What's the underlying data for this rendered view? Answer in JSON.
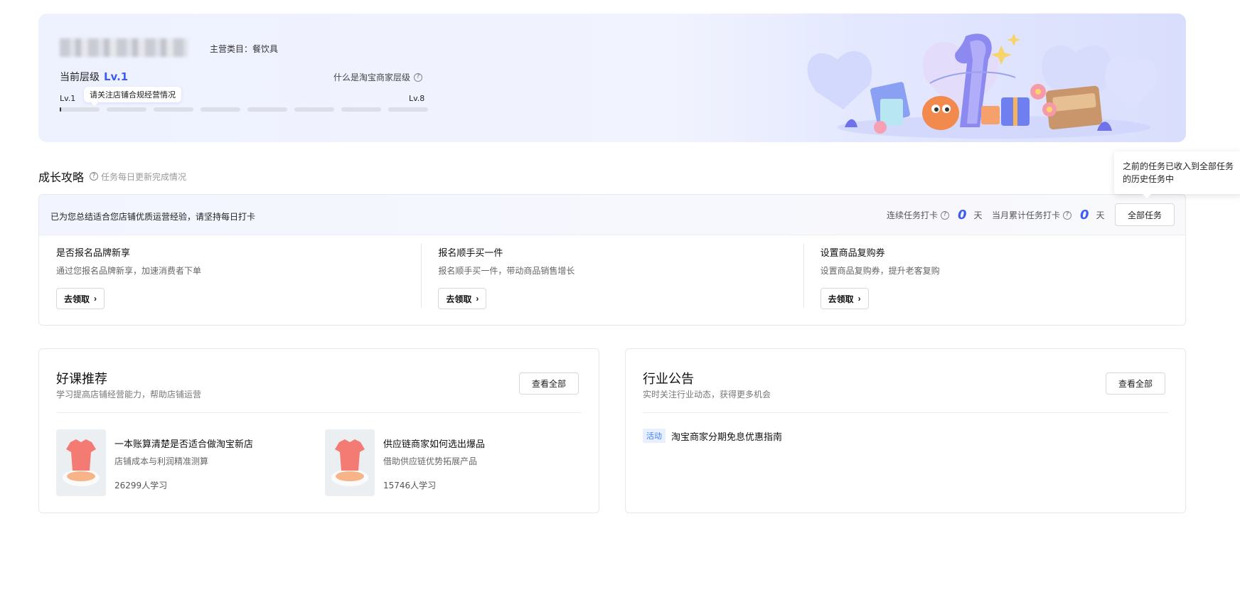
{
  "banner": {
    "category": "主营类目：餐饮具",
    "current_level_label": "当前层级",
    "current_level": "Lv.1",
    "what_is_level": "什么是淘宝商家层级",
    "level_start": "Lv.1",
    "level_end": "Lv.8",
    "level_tip": "请关注店铺合规经营情况",
    "level_segments": 8
  },
  "growth": {
    "title": "成长攻略",
    "subtitle": "任务每日更新完成情况",
    "summary": "已为您总结适合您店铺优质运营经验，请坚持每日打卡",
    "streak_label": "连续任务打卡",
    "streak_value": "0",
    "streak_unit": "天",
    "monthly_label": "当月累计任务打卡",
    "monthly_value": "0",
    "monthly_unit": "天",
    "all_tasks_label": "全部任务",
    "tooltip": "之前的任务已收入到全部任务的历史任务中",
    "tasks": [
      {
        "title": "是否报名品牌新享",
        "desc": "通过您报名品牌新享，加速消费者下单",
        "button": "去领取"
      },
      {
        "title": "报名顺手买一件",
        "desc": "报名顺手买一件，带动商品销售增长",
        "button": "去领取"
      },
      {
        "title": "设置商品复购券",
        "desc": "设置商品复购券，提升老客复购",
        "button": "去领取"
      }
    ]
  },
  "courses": {
    "title": "好课推荐",
    "subtitle": "学习提高店铺经营能力，帮助店铺运营",
    "view_all": "查看全部",
    "items": [
      {
        "title": "一本账算清楚是否适合做淘宝新店",
        "desc": "店铺成本与利润精准测算",
        "learners": "26299人学习"
      },
      {
        "title": "供应链商家如何选出爆品",
        "desc": "借助供应链优势拓展产品",
        "learners": "15746人学习"
      }
    ]
  },
  "notice": {
    "title": "行业公告",
    "subtitle": "实时关注行业动态，获得更多机会",
    "view_all": "查看全部",
    "items": [
      {
        "tag": "活动",
        "text": "淘宝商家分期免息优惠指南"
      }
    ]
  },
  "colors": {
    "accent": "#3d5cf5",
    "tag": "#3d7cf5"
  },
  "icons": [
    "question-circle-icon",
    "chevron-right-icon"
  ]
}
